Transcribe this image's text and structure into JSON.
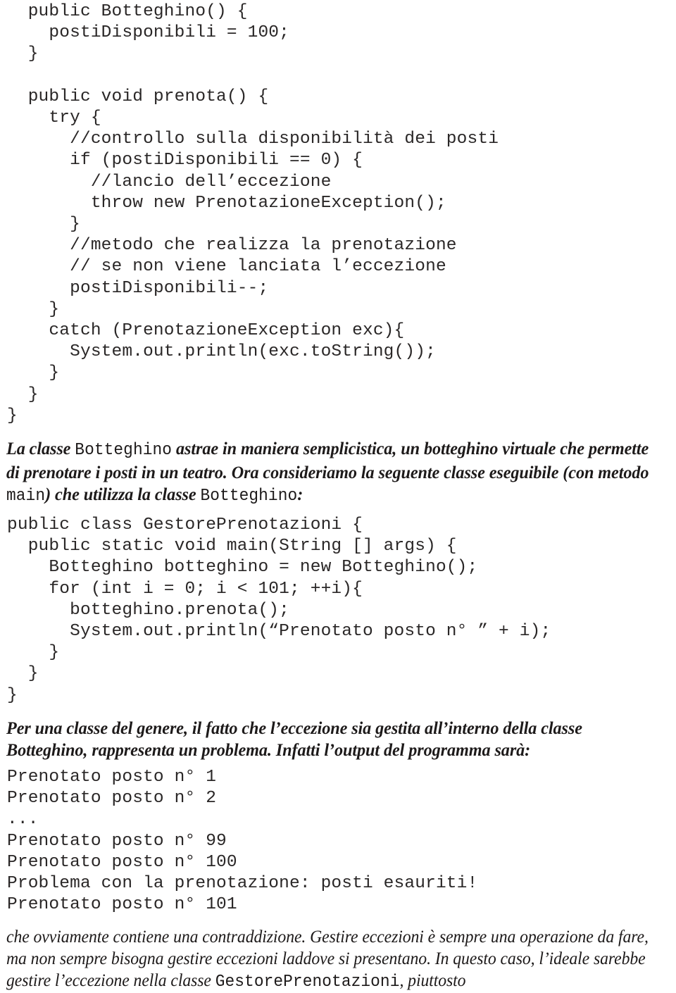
{
  "document": {
    "language": "it",
    "topic": "Java exception handling example (Botteghino / GestorePrenotazioni)"
  },
  "code_block_botteghino": {
    "name": "botteghino-class-code",
    "lines": [
      "  public Botteghino() {",
      "    postiDisponibili = 100;",
      "  }",
      "",
      "  public void prenota() {",
      "    try {",
      "      //controllo sulla disponibilità dei posti",
      "      if (postiDisponibili == 0) {",
      "        //lancio dell’eccezione",
      "        throw new PrenotazioneException();",
      "      }",
      "      //metodo che realizza la prenotazione",
      "      // se non viene lanciata l’eccezione",
      "      postiDisponibili--;",
      "    }",
      "    catch (PrenotazioneException exc){",
      "      System.out.println(exc.toString());",
      "    }",
      "  }",
      "}"
    ]
  },
  "prose_intro": {
    "name": "intro-paragraph",
    "segments": [
      {
        "type": "italic",
        "text": "La classe "
      },
      {
        "type": "mono",
        "text": "Botteghino"
      },
      {
        "type": "italic",
        "text": " astrae in maniera semplicistica, un botteghino virtuale che permette di prenotare i posti in un teatro. Ora consideriamo la seguente classe eseguibile (con metodo "
      },
      {
        "type": "mono",
        "text": "main"
      },
      {
        "type": "italic",
        "text": ") che utilizza la classe "
      },
      {
        "type": "mono",
        "text": "Botteghino"
      },
      {
        "type": "italic",
        "text": ":"
      }
    ]
  },
  "code_block_gestore": {
    "name": "gestore-prenotazioni-code",
    "lines": [
      "public class GestorePrenotazioni {",
      "  public static void main(String [] args) {",
      "    Botteghino botteghino = new Botteghino();",
      "    for (int i = 0; i < 101; ++i){",
      "      botteghino.prenota();",
      "      System.out.println(“Prenotato posto n° ” + i);",
      "    }",
      "  }",
      "}"
    ]
  },
  "prose_problem": {
    "name": "problem-paragraph",
    "segments": [
      {
        "type": "italic",
        "text": "Per una classe del genere, il fatto che l’eccezione sia gestita all’interno della classe Botteghino, rappresenta un problema. Infatti l’output del programma sarà:"
      }
    ]
  },
  "code_block_output": {
    "name": "program-output",
    "lines": [
      "Prenotato posto n° 1",
      "Prenotato posto n° 2",
      "...",
      "Prenotato posto n° 99",
      "Prenotato posto n° 100",
      "Problema con la prenotazione: posti esauriti!",
      "Prenotato posto n° 101"
    ]
  },
  "prose_closing": {
    "name": "closing-paragraph",
    "segments": [
      {
        "type": "italic",
        "text": "che ovviamente contiene una contraddizione. Gestire eccezioni è sempre una operazione da fare, ma non sempre bisogna gestire eccezioni laddove si presentano. In questo caso, l’ideale sarebbe gestire l’eccezione nella classe "
      },
      {
        "type": "mono",
        "text": "GestorePrenotazioni"
      },
      {
        "type": "italic",
        "text": ", piuttosto"
      }
    ]
  }
}
